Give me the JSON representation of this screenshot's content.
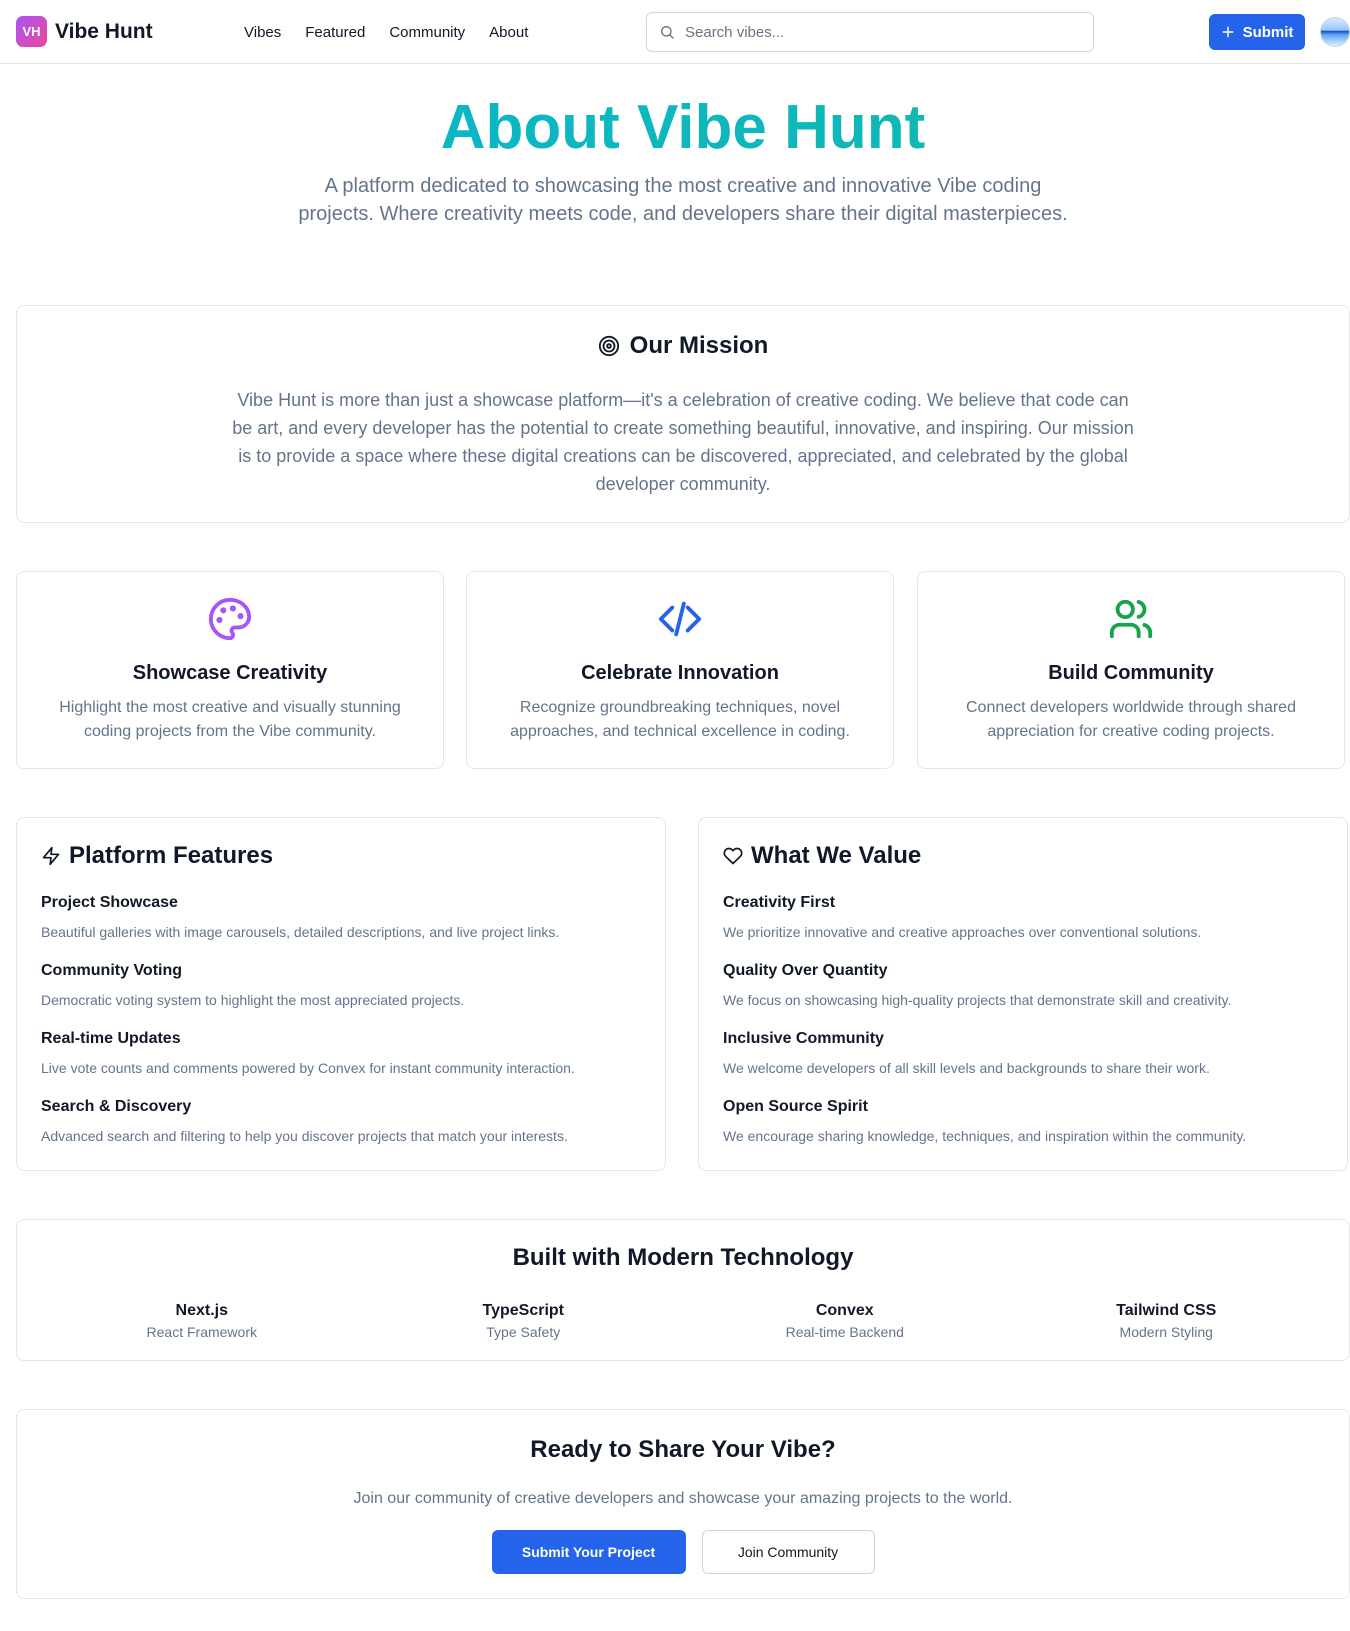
{
  "header": {
    "logo_badge": "VH",
    "logo_text": "Vibe Hunt",
    "nav": [
      "Vibes",
      "Featured",
      "Community",
      "About"
    ],
    "search_placeholder": "Search vibes...",
    "submit_label": "Submit"
  },
  "hero": {
    "title": "About Vibe Hunt",
    "subtitle": "A platform dedicated to showcasing the most creative and innovative Vibe coding projects. Where creativity meets code, and developers share their digital masterpieces."
  },
  "mission": {
    "title": "Our Mission",
    "text": "Vibe Hunt is more than just a showcase platform—it's a celebration of creative coding. We believe that code can be art, and every developer has the potential to create something beautiful, innovative, and inspiring. Our mission is to provide a space where these digital creations can be discovered, appreciated, and celebrated by the global developer community."
  },
  "pillars": [
    {
      "icon": "palette-icon",
      "color": "#a855f7",
      "title": "Showcase Creativity",
      "text": "Highlight the most creative and visually stunning coding projects from the Vibe community."
    },
    {
      "icon": "code-icon",
      "color": "#2563eb",
      "title": "Celebrate Innovation",
      "text": "Recognize groundbreaking techniques, novel approaches, and technical excellence in coding."
    },
    {
      "icon": "users-icon",
      "color": "#16a34a",
      "title": "Build Community",
      "text": "Connect developers worldwide through shared appreciation for creative coding projects."
    }
  ],
  "features": {
    "title": "Platform Features",
    "items": [
      {
        "title": "Project Showcase",
        "text": "Beautiful galleries with image carousels, detailed descriptions, and live project links."
      },
      {
        "title": "Community Voting",
        "text": "Democratic voting system to highlight the most appreciated projects."
      },
      {
        "title": "Real-time Updates",
        "text": "Live vote counts and comments powered by Convex for instant community interaction."
      },
      {
        "title": "Search & Discovery",
        "text": "Advanced search and filtering to help you discover projects that match your interests."
      }
    ]
  },
  "values": {
    "title": "What We Value",
    "items": [
      {
        "title": "Creativity First",
        "text": "We prioritize innovative and creative approaches over conventional solutions."
      },
      {
        "title": "Quality Over Quantity",
        "text": "We focus on showcasing high-quality projects that demonstrate skill and creativity."
      },
      {
        "title": "Inclusive Community",
        "text": "We welcome developers of all skill levels and backgrounds to share their work."
      },
      {
        "title": "Open Source Spirit",
        "text": "We encourage sharing knowledge, techniques, and inspiration within the community."
      }
    ]
  },
  "tech": {
    "title": "Built with Modern Technology",
    "items": [
      {
        "name": "Next.js",
        "desc": "React Framework"
      },
      {
        "name": "TypeScript",
        "desc": "Type Safety"
      },
      {
        "name": "Convex",
        "desc": "Real-time Backend"
      },
      {
        "name": "Tailwind CSS",
        "desc": "Modern Styling"
      }
    ]
  },
  "cta": {
    "title": "Ready to Share Your Vibe?",
    "subtitle": "Join our community of creative developers and showcase your amazing projects to the world.",
    "primary": "Submit Your Project",
    "secondary": "Join Community"
  },
  "colors": {
    "accent": "#2563eb",
    "brand_gradient_start": "#a855f7",
    "brand_gradient_end": "#ec4899",
    "hero_gradient_start": "#06b6d4",
    "hero_gradient_end": "#14b8a6"
  }
}
